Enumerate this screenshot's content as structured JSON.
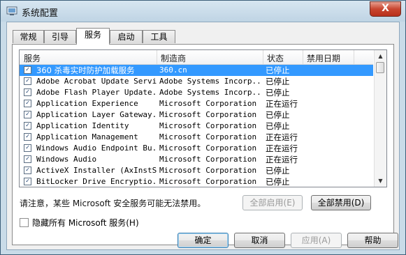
{
  "window": {
    "title": "系统配置",
    "close_glyph": "X"
  },
  "tabs": [
    {
      "label": "常规"
    },
    {
      "label": "引导"
    },
    {
      "label": "服务"
    },
    {
      "label": "启动"
    },
    {
      "label": "工具"
    }
  ],
  "active_tab": "服务",
  "list": {
    "headers": {
      "service": "服务",
      "manufacturer": "制造商",
      "status": "状态",
      "disabled_date": "禁用日期"
    },
    "rows": [
      {
        "checked": true,
        "name": "360 杀毒实时防护加载服务",
        "manufacturer": "360.cn",
        "status": "已停止"
      },
      {
        "checked": true,
        "name": "Adobe Acrobat Update Service",
        "manufacturer": "Adobe Systems Incorp...",
        "status": "已停止"
      },
      {
        "checked": true,
        "name": "Adobe Flash Player Update...",
        "manufacturer": "Adobe Systems Incorp...",
        "status": "已停止"
      },
      {
        "checked": true,
        "name": "Application Experience",
        "manufacturer": "Microsoft Corporation",
        "status": "正在运行"
      },
      {
        "checked": true,
        "name": "Application Layer Gateway...",
        "manufacturer": "Microsoft Corporation",
        "status": "已停止"
      },
      {
        "checked": true,
        "name": "Application Identity",
        "manufacturer": "Microsoft Corporation",
        "status": "已停止"
      },
      {
        "checked": true,
        "name": "Application Management",
        "manufacturer": "Microsoft Corporation",
        "status": "正在运行"
      },
      {
        "checked": true,
        "name": "Windows Audio Endpoint Bu...",
        "manufacturer": "Microsoft Corporation",
        "status": "正在运行"
      },
      {
        "checked": true,
        "name": "Windows Audio",
        "manufacturer": "Microsoft Corporation",
        "status": "正在运行"
      },
      {
        "checked": true,
        "name": "ActiveX Installer (AxInstSV)",
        "manufacturer": "Microsoft Corporation",
        "status": "已停止"
      },
      {
        "checked": true,
        "name": "BitLocker Drive Encryptio...",
        "manufacturer": "Microsoft Corporation",
        "status": "已停止"
      }
    ]
  },
  "note": "请注意，某些 Microsoft 安全服务可能无法禁用。",
  "buttons": {
    "enable_all": "全部启用(E)",
    "disable_all": "全部禁用(D)",
    "ok": "确定",
    "cancel": "取消",
    "apply": "应用(A)",
    "help": "帮助"
  },
  "hide_ms": {
    "checked": false,
    "label": "隐藏所有 Microsoft 服务(H)"
  },
  "colors": {
    "selection": "#3399ff",
    "window_frame": "#c9dbe8"
  }
}
